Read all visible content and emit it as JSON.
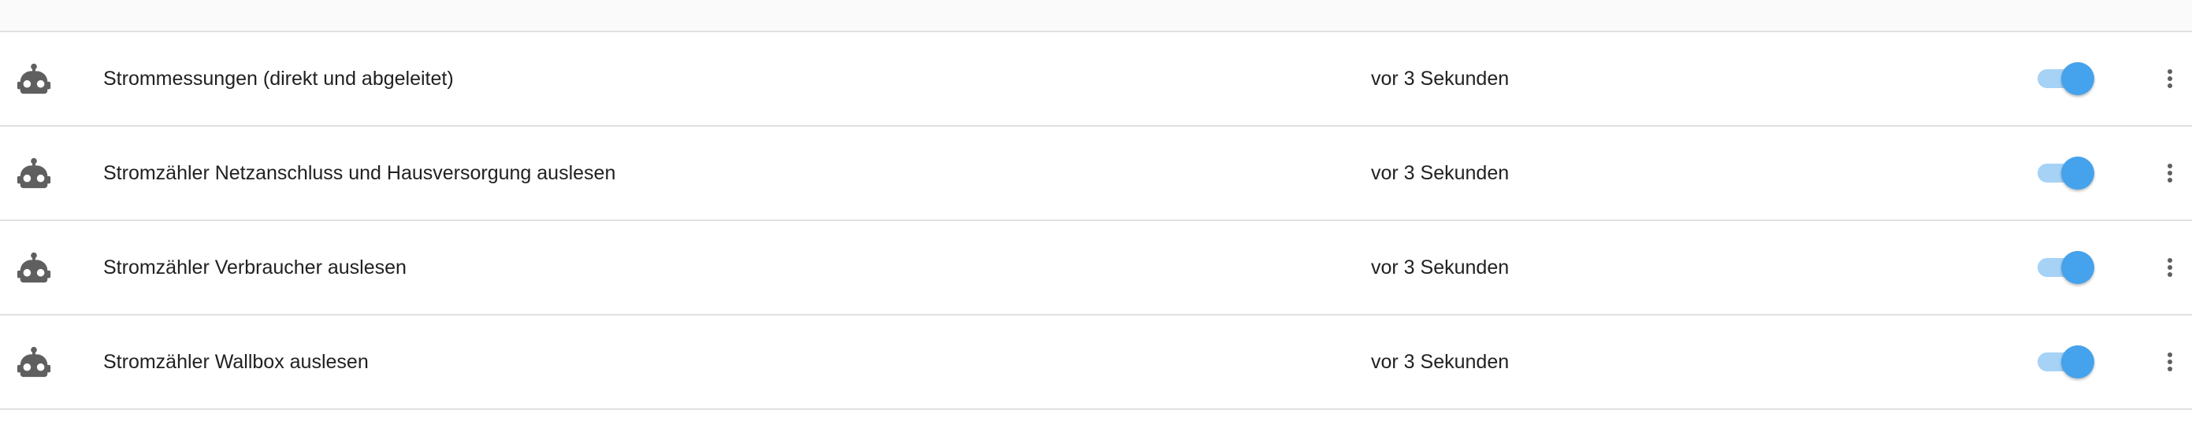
{
  "group_header": {
    "label": ""
  },
  "rows": [
    {
      "name": "Strommessungen (direkt und abgeleitet)",
      "last_triggered": "vor 3 Sekunden",
      "enabled": true,
      "icon": "robot-icon"
    },
    {
      "name": "Stromzähler Netzanschluss und Hausversorgung auslesen",
      "last_triggered": "vor 3 Sekunden",
      "enabled": true,
      "icon": "robot-icon"
    },
    {
      "name": "Stromzähler Verbraucher auslesen",
      "last_triggered": "vor 3 Sekunden",
      "enabled": true,
      "icon": "robot-icon"
    },
    {
      "name": "Stromzähler Wallbox auslesen",
      "last_triggered": "vor 3 Sekunden",
      "enabled": true,
      "icon": "robot-icon"
    }
  ],
  "colors": {
    "icon": "#5f5f5f",
    "toggle_thumb": "#45a2ec",
    "toggle_track": "#a6d2f6",
    "divider": "#e0e0e0",
    "header_background": "#fafafa"
  }
}
